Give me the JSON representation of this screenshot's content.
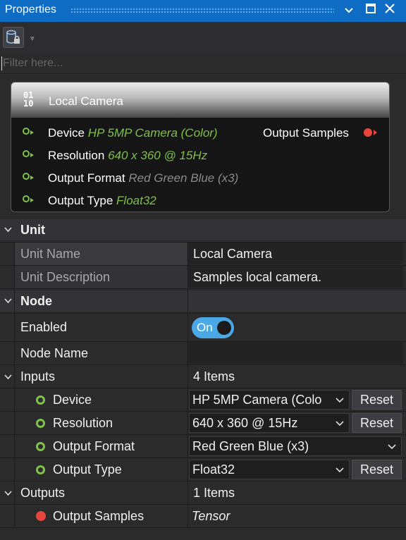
{
  "window": {
    "title": "Properties"
  },
  "toolbar": {
    "overflow_glyph": "⩔"
  },
  "filter": {
    "placeholder": "Filter here..."
  },
  "node": {
    "icon": "01\n10",
    "title": "Local Camera",
    "ports": [
      {
        "name": "Device",
        "value": "HP 5MP Camera (Color)"
      },
      {
        "name": "Resolution",
        "value": "640 x 360 @ 15Hz"
      },
      {
        "name": "Output Format",
        "value": "Red Green Blue (x3)"
      },
      {
        "name": "Output Type",
        "value": "Float32"
      }
    ],
    "output_port": "Output Samples"
  },
  "grid": {
    "unit": {
      "header": "Unit",
      "name_label": "Unit Name",
      "name_value": "Local Camera",
      "desc_label": "Unit Description",
      "desc_value": "Samples local camera."
    },
    "node": {
      "header": "Node",
      "enabled_label": "Enabled",
      "enabled_value": "On",
      "node_name_label": "Node Name",
      "node_name_value": ""
    },
    "inputs": {
      "label": "Inputs",
      "count": "4 Items",
      "items": [
        {
          "label": "Device",
          "value": "HP 5MP Camera (Colo",
          "reset": "Reset"
        },
        {
          "label": "Resolution",
          "value": "640 x 360 @ 15Hz",
          "reset": "Reset"
        },
        {
          "label": "Output Format",
          "value": "Red Green Blue (x3)"
        },
        {
          "label": "Output Type",
          "value": "Float32",
          "reset": "Reset"
        }
      ]
    },
    "outputs": {
      "label": "Outputs",
      "count": "1 Items",
      "items": [
        {
          "label": "Output Samples",
          "value": "Tensor"
        }
      ]
    }
  },
  "colors": {
    "accent": "#0e6cc4",
    "input_port": "#7ec24a",
    "output_port": "#e8463c",
    "toggle_on": "#4aa8e6"
  }
}
